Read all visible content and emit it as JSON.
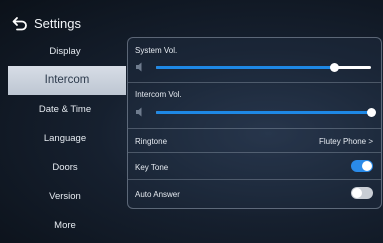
{
  "header": {
    "title": "Settings"
  },
  "sidebar": {
    "items": [
      {
        "label": "Display"
      },
      {
        "label": "Intercom"
      },
      {
        "label": "Date & Time"
      },
      {
        "label": "Language"
      },
      {
        "label": "Doors"
      },
      {
        "label": "Version"
      },
      {
        "label": "More"
      }
    ],
    "active_index": 1
  },
  "panel": {
    "system_vol": {
      "label": "System Vol.",
      "level": 0.83
    },
    "intercom_vol": {
      "label": "Intercom Vol.",
      "level": 1.0
    },
    "ringtone": {
      "label": "Ringtone",
      "value": "Flutey Phone",
      "chevron": ">"
    },
    "key_tone": {
      "label": "Key Tone",
      "on": true
    },
    "auto_answer": {
      "label": "Auto Answer",
      "on": false
    }
  },
  "colors": {
    "accent": "#1e88e5",
    "toggle_on": "#2a8ae8",
    "toggle_off": "#c9ced5"
  }
}
